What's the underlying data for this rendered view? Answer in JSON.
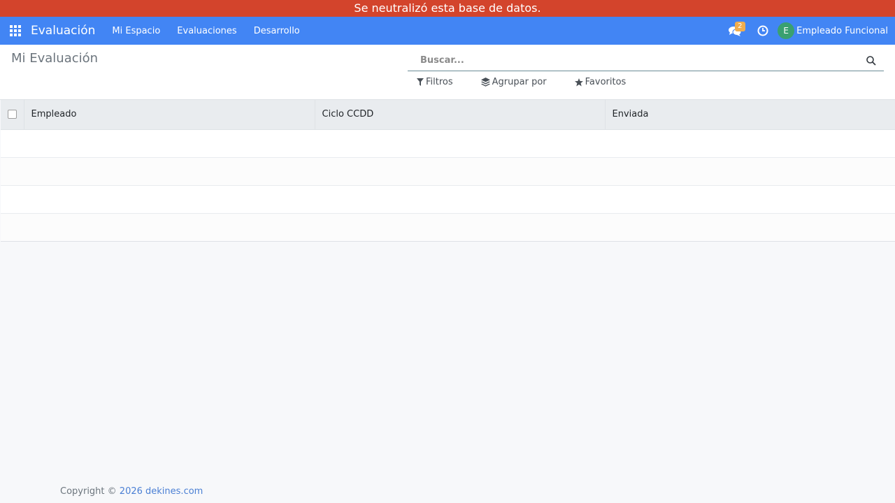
{
  "banner": {
    "text": "Se neutralizó esta base de datos."
  },
  "navbar": {
    "apps_icon": "apps-grid-icon",
    "brand": "Evaluación",
    "menu": [
      "Mi Espacio",
      "Evaluaciones",
      "Desarrollo"
    ],
    "messages_icon": "chat-bubbles-icon",
    "messages_count": "2",
    "activities_icon": "clock-icon",
    "user_initial": "E",
    "user_name": "Empleado Funcional",
    "accent_color": "#4285f4"
  },
  "control_panel": {
    "breadcrumb": "Mi Evaluación",
    "search_placeholder": "Buscar...",
    "search_value": "",
    "filters_label": "Filtros",
    "group_by_label": "Agrupar por",
    "favorites_label": "Favoritos"
  },
  "table": {
    "columns": [
      "Empleado",
      "Ciclo CCDD",
      "Enviada"
    ],
    "rows": []
  },
  "footer": {
    "prefix": "Copyright ©",
    "year": "2026",
    "site": "dekines.com"
  },
  "colors": {
    "banner": "#d3442c",
    "navbar": "#4285f4",
    "background": "#f7f8fa"
  }
}
